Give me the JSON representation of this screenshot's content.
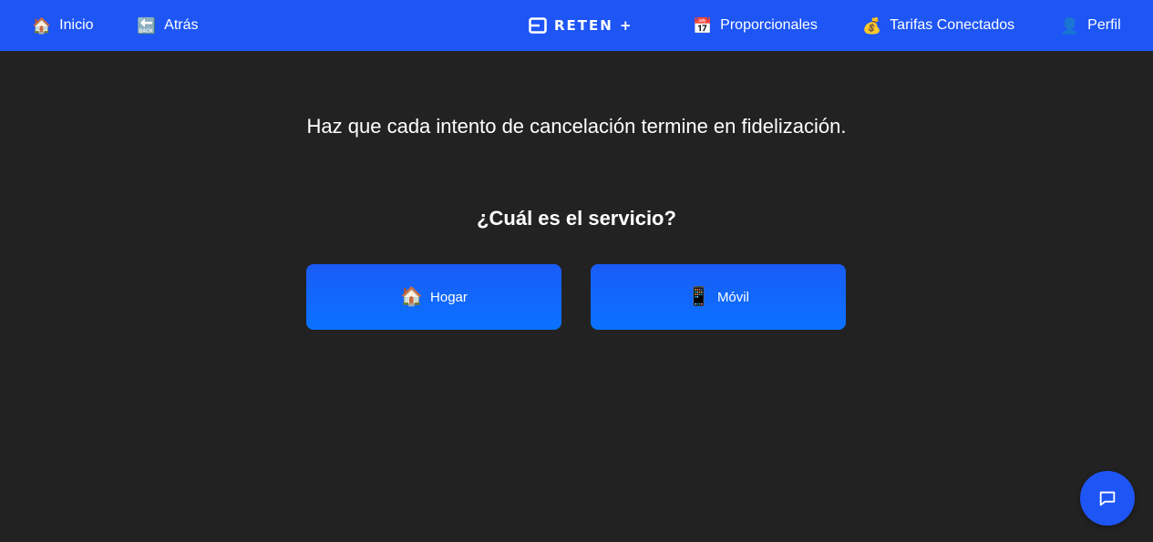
{
  "nav": {
    "home": {
      "icon": "🏠",
      "label": "Inicio"
    },
    "back": {
      "icon": "🔙",
      "label": "Atrás"
    },
    "logo_text": "RETEN +",
    "proportional": {
      "icon": "📅",
      "label": "Proporcionales"
    },
    "rates": {
      "icon": "💰",
      "label": "Tarifas Conectados"
    },
    "profile": {
      "icon": "👤",
      "label": "Perfil"
    }
  },
  "main": {
    "tagline": "Haz que cada intento de cancelación termine en fidelización.",
    "question": "¿Cuál es el servicio?",
    "services": [
      {
        "icon": "🏠",
        "label": "Hogar"
      },
      {
        "icon": "📱",
        "label": "Móvil"
      }
    ]
  },
  "chat": {
    "icon": "chat-bubble-icon"
  },
  "colors": {
    "topbar": "#1e55f5",
    "background": "#222222",
    "button": "#0a6cff",
    "text": "#ffffff"
  }
}
